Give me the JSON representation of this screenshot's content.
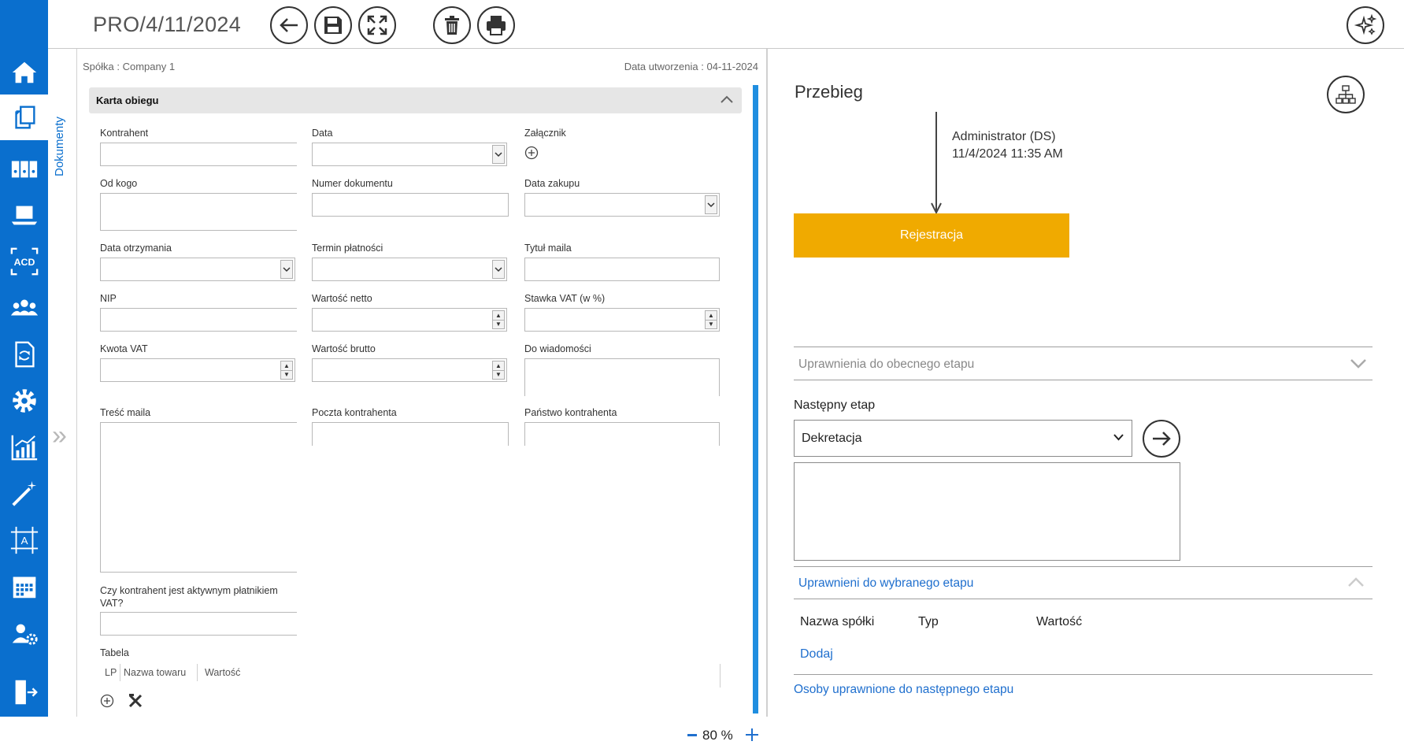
{
  "header": {
    "title": "PRO/4/11/2024"
  },
  "toolbar": {
    "back_icon": "arrow-left-icon",
    "save_icon": "floppy-disk-icon",
    "fullscreen_icon": "expand-icon",
    "delete_icon": "trash-icon",
    "print_icon": "printer-icon",
    "ai_icon": "sparkles-icon"
  },
  "nav": {
    "items": [
      "home-icon",
      "documents-icon",
      "binders-icon",
      "laptop-icon",
      "ocr-acd-icon",
      "users-group-icon",
      "document-sync-icon",
      "gear-icon",
      "chart-icon",
      "magic-wand-icon",
      "text-frame-icon",
      "calendar-icon",
      "user-settings-icon",
      "logout-icon"
    ],
    "ocr_label": "ACD",
    "frame_label": "A"
  },
  "sidetab": {
    "label": "Dokumenty"
  },
  "form": {
    "company": "Spółka : Company 1",
    "created": "Data utworzenia : 04-11-2024",
    "section_title": "Karta obiegu",
    "labels": {
      "kontrahent": "Kontrahent",
      "data": "Data",
      "zalacznik": "Załącznik",
      "od_kogo": "Od kogo",
      "numer_dokumentu": "Numer dokumentu",
      "data_zakupu": "Data zakupu",
      "data_otrzymania": "Data otrzymania",
      "termin_platnosci": "Termin płatności",
      "tytul_maila": "Tytuł maila",
      "nip": "NIP",
      "wartosc_netto": "Wartość netto",
      "stawka_vat": "Stawka VAT (w %)",
      "kwota_vat": "Kwota VAT",
      "wartosc_brutto": "Wartość brutto",
      "do_wiadomosci": "Do wiadomości",
      "tresc_maila": "Treść maila",
      "poczta_kontrahenta": "Poczta kontrahenta",
      "panstwo_kontrahenta": "Państwo kontrahenta",
      "czy_vat_line1": "Czy kontrahent jest aktywnym płatnikiem",
      "czy_vat_line2": "VAT?",
      "tabela": "Tabela"
    },
    "table_columns": [
      "LP",
      "Nazwa towaru",
      "Wartość"
    ],
    "zoom": "80 %"
  },
  "workflow": {
    "title": "Przebieg",
    "user": "Administrator (DS)",
    "timestamp": "11/4/2024 11:35 AM",
    "current_stage": "Rejestracja",
    "stage_color": "#f0aa00",
    "permissions_current": "Uprawnienia do obecnego etapu",
    "next_stage_label": "Następny etap",
    "next_stage_value": "Dekretacja",
    "permissions_selected": "Uprawnieni do wybranego etapu",
    "columns": [
      "Nazwa spółki",
      "Typ",
      "Wartość"
    ],
    "add": "Dodaj",
    "next_users": "Osoby uprawnione do następnego etapu"
  },
  "colors": {
    "accent": "#0a6fce",
    "link": "#1f6fce"
  }
}
